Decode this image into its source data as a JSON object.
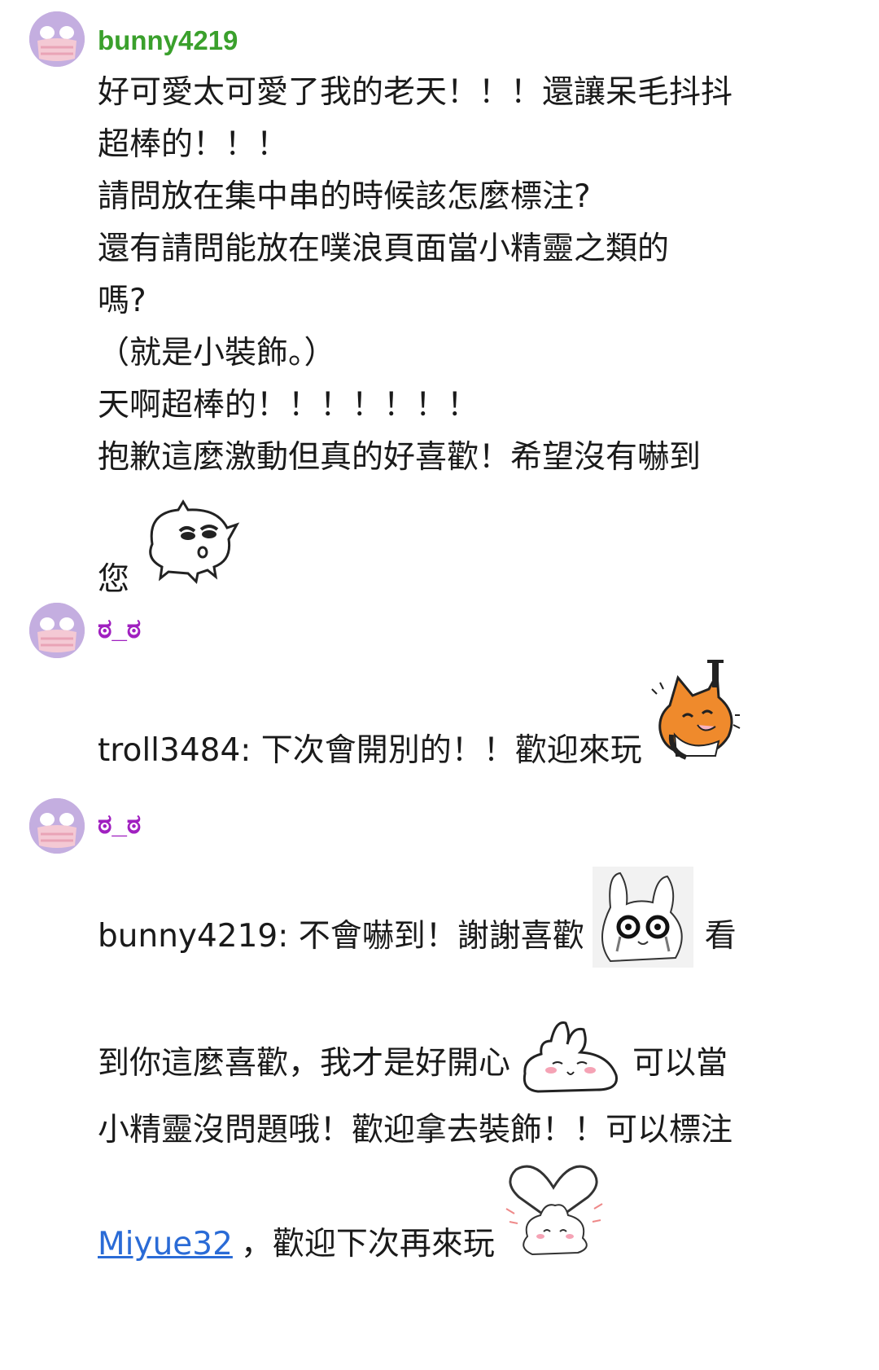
{
  "posts": [
    {
      "username": "bunny4219",
      "username_color": "#3aa02c",
      "avatar": "masked-owl-avatar",
      "lines": [
        "好可愛太可愛了我的老天！！！還讓呆毛抖抖",
        "超棒的！！！",
        "請問放在集中串的時候該怎麼標注?",
        "還有請問能放在噗浪頁面當小精靈之類的",
        "嗎?",
        "（就是小裝飾。）",
        "天啊超棒的！！！！！！！",
        "抱歉這麼激動但真的好喜歡！希望沒有嚇到"
      ],
      "last_line": "您",
      "sticker": "blob-creature-sticker"
    },
    {
      "username": "ಠ_ಠ",
      "username_color": "#a020c0",
      "avatar": "masked-owl-avatar",
      "text": "troll3484: 下次會開別的！！歡迎來玩",
      "sticker": "cheering-fox-sticker"
    },
    {
      "username": "ಠ_ಠ",
      "username_color": "#a020c0",
      "avatar": "masked-owl-avatar",
      "line1_a": "bunny4219: 不會嚇到！謝謝喜歡",
      "line1_b": "看",
      "line2_a": "到你這麼喜歡，我才是好開心",
      "line2_b": "可以當",
      "line3": "小精靈沒問題哦！歡迎拿去裝飾！！可以標注",
      "link": "Miyue32",
      "line4_rest": "，歡迎下次再來玩",
      "stickers": [
        "crying-bunny-sticker",
        "blushing-bunny-sticker",
        "heart-bunny-sticker"
      ]
    }
  ]
}
